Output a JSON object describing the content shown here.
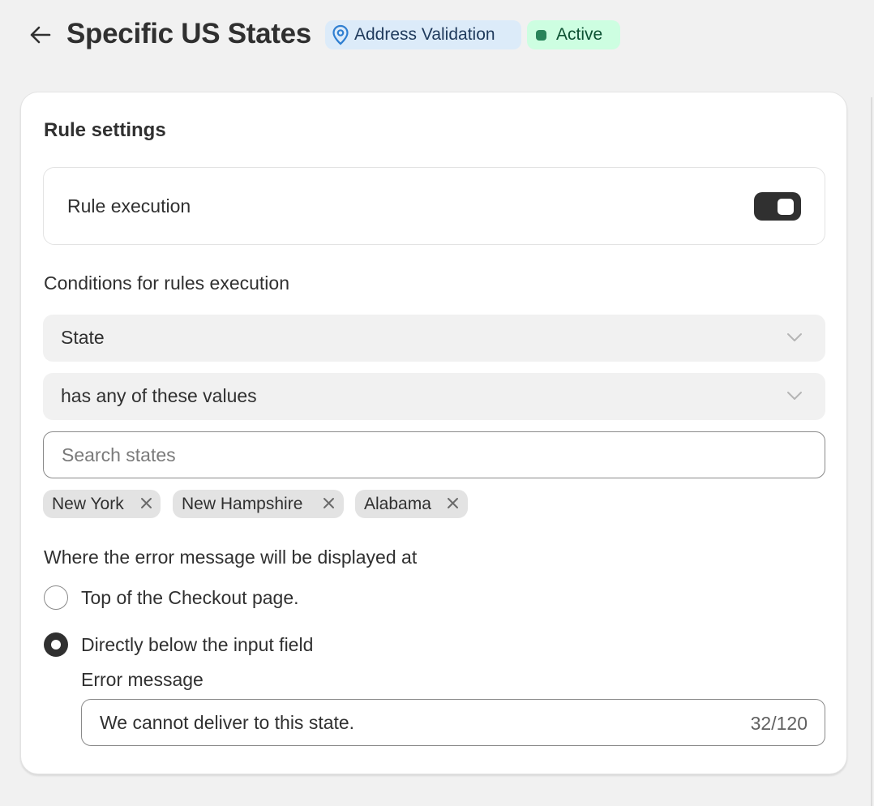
{
  "header": {
    "title": "Specific US States",
    "type_badge": "Address Validation",
    "status_badge": "Active"
  },
  "card": {
    "title": "Rule settings",
    "rule_execution": {
      "label": "Rule execution",
      "enabled": true
    },
    "conditions": {
      "label": "Conditions for rules execution",
      "field_select": "State",
      "operator_select": "has any of these values",
      "search_placeholder": "Search states",
      "selected_values": [
        "New York",
        "New Hampshire",
        "Alabama"
      ]
    },
    "display": {
      "label": "Where the error message will be displayed at",
      "options": [
        {
          "label": "Top of the Checkout page.",
          "selected": false
        },
        {
          "label": "Directly below the input field",
          "selected": true
        }
      ],
      "error_message_label": "Error message",
      "error_message_value": "We cannot deliver to this state.",
      "char_count": "32/120"
    }
  },
  "icons": {
    "back": "arrow-left-icon",
    "location": "location-pin-icon",
    "chevron": "chevron-down-icon",
    "remove": "close-icon"
  },
  "colors": {
    "page_bg": "#f1f1f1",
    "type_badge_bg": "#dcebf9",
    "status_badge_bg": "#cdfee1",
    "status_dot": "#29845a",
    "toggle_on": "#303030"
  }
}
